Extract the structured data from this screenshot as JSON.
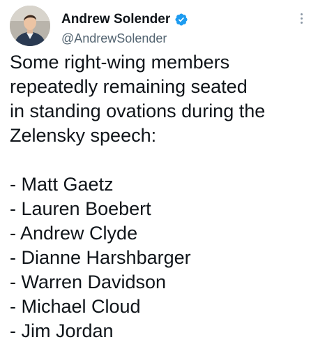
{
  "author": {
    "name": "Andrew Solender",
    "handle": "@AndrewSolender",
    "verified": true,
    "avatar_icon": "profile-photo"
  },
  "tweet": {
    "intro": "Some right-wing members\nrepeatedly remaining seated\nin standing ovations during the\nZelensky speech:",
    "list": [
      "- Matt Gaetz",
      "- Lauren Boebert",
      "- Andrew Clyde",
      "- Dianne Harshbarger",
      "- Warren Davidson",
      "- Michael Cloud",
      "- Jim Jordan"
    ]
  },
  "colors": {
    "text": "#0f1419",
    "secondary": "#536471",
    "verified_blue": "#1d9bf0"
  }
}
